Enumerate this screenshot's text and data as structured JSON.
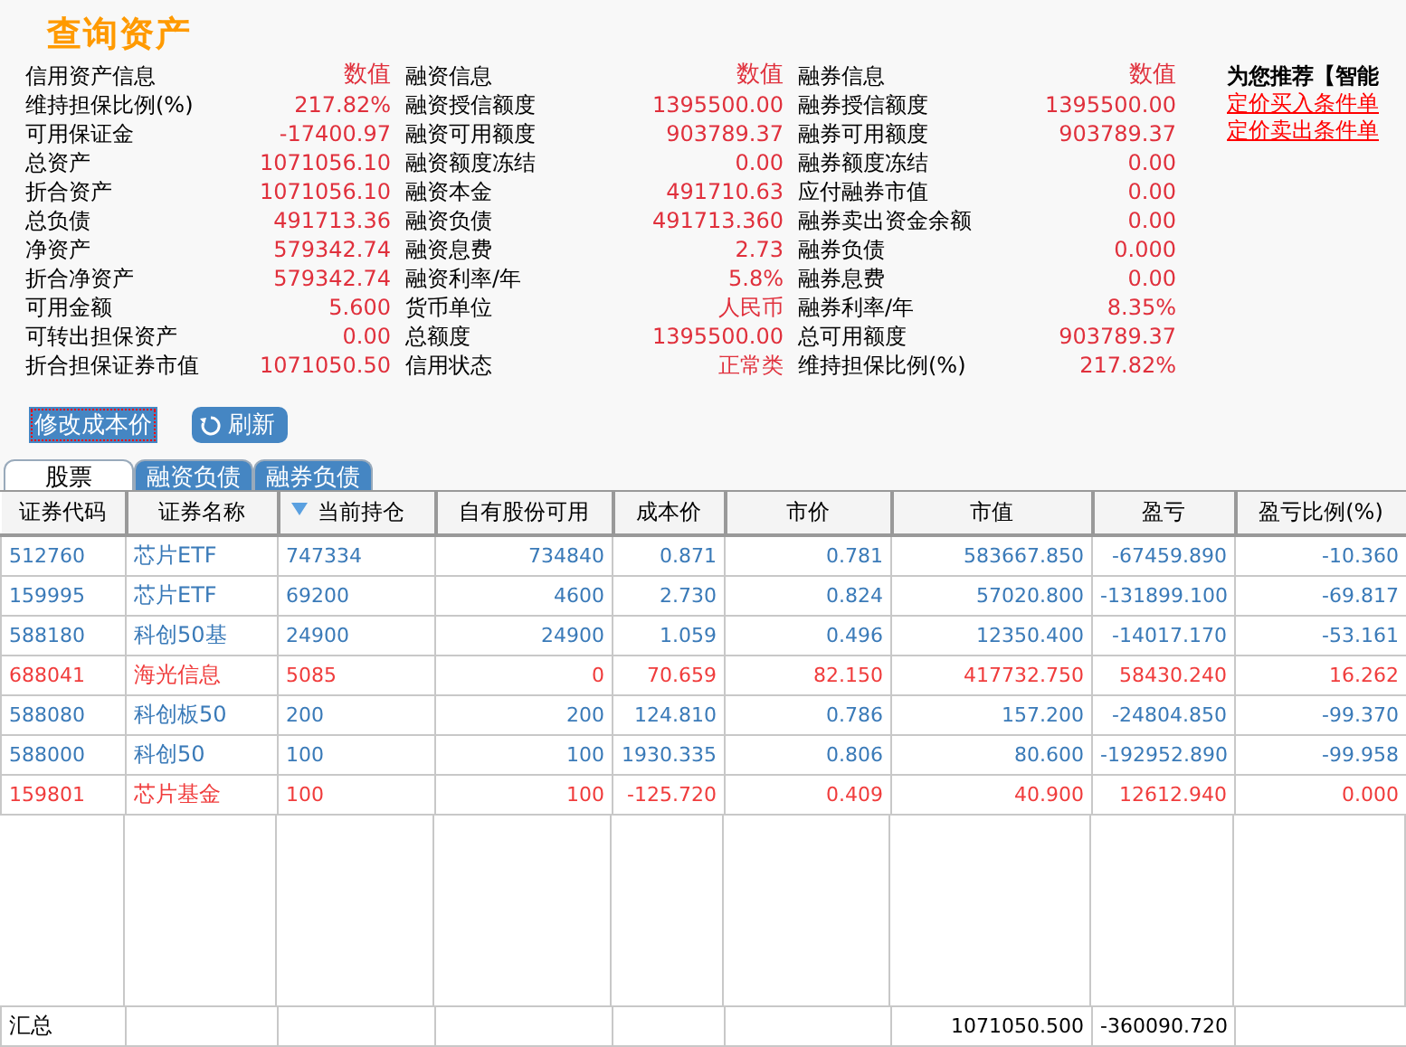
{
  "title": "查询资产",
  "info_groups": [
    {
      "header": "信用资产信息",
      "value_header": "数值",
      "rows": [
        {
          "label": "维持担保比例(%)",
          "value": "217.82%"
        },
        {
          "label": "可用保证金",
          "value": "-17400.97"
        },
        {
          "label": "总资产",
          "value": "1071056.10"
        },
        {
          "label": "折合资产",
          "value": "1071056.10"
        },
        {
          "label": "总负债",
          "value": "491713.36"
        },
        {
          "label": "净资产",
          "value": "579342.74"
        },
        {
          "label": "折合净资产",
          "value": "579342.74"
        },
        {
          "label": "可用金额",
          "value": "5.600"
        },
        {
          "label": "可转出担保资产",
          "value": "0.00"
        },
        {
          "label": "折合担保证券市值",
          "value": "1071050.50"
        }
      ]
    },
    {
      "header": "融资信息",
      "value_header": "数值",
      "rows": [
        {
          "label": "融资授信额度",
          "value": "1395500.00"
        },
        {
          "label": "融资可用额度",
          "value": "903789.37"
        },
        {
          "label": "融资额度冻结",
          "value": "0.00"
        },
        {
          "label": "融资本金",
          "value": "491710.63"
        },
        {
          "label": "融资负债",
          "value": "491713.360"
        },
        {
          "label": "融资息费",
          "value": "2.73"
        },
        {
          "label": "融资利率/年",
          "value": "5.8%"
        },
        {
          "label": "货币单位",
          "value": "人民币"
        },
        {
          "label": "总额度",
          "value": "1395500.00"
        },
        {
          "label": "信用状态",
          "value": "正常类"
        }
      ]
    },
    {
      "header": "融券信息",
      "value_header": "数值",
      "rows": [
        {
          "label": "融券授信额度",
          "value": "1395500.00"
        },
        {
          "label": "融券可用额度",
          "value": "903789.37"
        },
        {
          "label": "融券额度冻结",
          "value": "0.00"
        },
        {
          "label": "应付融券市值",
          "value": "0.00"
        },
        {
          "label": "融券卖出资金余额",
          "value": "0.00"
        },
        {
          "label": "融券负债",
          "value": "0.000"
        },
        {
          "label": "融券息费",
          "value": "0.00"
        },
        {
          "label": "融券利率/年",
          "value": "8.35%"
        },
        {
          "label": "总可用额度",
          "value": "903789.37"
        },
        {
          "label": "维持担保比例(%)",
          "value": "217.82%"
        }
      ]
    }
  ],
  "recommend": {
    "heading": "为您推荐【智能",
    "links": [
      "定价买入条件单",
      "定价卖出条件单"
    ]
  },
  "buttons": [
    {
      "label": "修改成本价",
      "focused": true,
      "kind": "plain"
    },
    {
      "label": "刷新",
      "focused": false,
      "kind": "refresh"
    }
  ],
  "tabs": [
    {
      "label": "股票",
      "selected": true
    },
    {
      "label": "融资负债",
      "selected": false
    },
    {
      "label": "融券负债",
      "selected": false
    }
  ],
  "table": {
    "columns": [
      {
        "label": "证券代码",
        "sorted": false
      },
      {
        "label": "证券名称",
        "sorted": false
      },
      {
        "label": "当前持仓",
        "sorted": true
      },
      {
        "label": "自有股份可用",
        "sorted": false
      },
      {
        "label": "成本价",
        "sorted": false
      },
      {
        "label": "市价",
        "sorted": false
      },
      {
        "label": "市值",
        "sorted": false
      },
      {
        "label": "盈亏",
        "sorted": false
      },
      {
        "label": "盈亏比例(%)",
        "sorted": false
      }
    ],
    "rows": [
      {
        "color": "#3a7ab8",
        "cells": [
          "512760",
          "芯片ETF",
          "747334",
          "734840",
          "0.871",
          "0.781",
          "583667.850",
          "-67459.890",
          "-10.360"
        ]
      },
      {
        "color": "#3a7ab8",
        "cells": [
          "159995",
          "芯片ETF",
          "69200",
          "4600",
          "2.730",
          "0.824",
          "57020.800",
          "-131899.100",
          "-69.817"
        ]
      },
      {
        "color": "#3a7ab8",
        "cells": [
          "588180",
          "科创50基",
          "24900",
          "24900",
          "1.059",
          "0.496",
          "12350.400",
          "-14017.170",
          "-53.161"
        ]
      },
      {
        "color": "#f03c3c",
        "cells": [
          "688041",
          "海光信息",
          "5085",
          "0",
          "70.659",
          "82.150",
          "417732.750",
          "58430.240",
          "16.262"
        ]
      },
      {
        "color": "#3a7ab8",
        "cells": [
          "588080",
          "科创板50",
          "200",
          "200",
          "124.810",
          "0.786",
          "157.200",
          "-24804.850",
          "-99.370"
        ]
      },
      {
        "color": "#3a7ab8",
        "cells": [
          "588000",
          "科创50",
          "100",
          "100",
          "1930.335",
          "0.806",
          "80.600",
          "-192952.890",
          "-99.958"
        ]
      },
      {
        "color": "#f03c3c",
        "cells": [
          "159801",
          "芯片基金",
          "100",
          "100",
          "-125.720",
          "0.409",
          "40.900",
          "12612.940",
          "0.000"
        ]
      }
    ],
    "total": {
      "label": "汇总",
      "market_value": "1071050.500",
      "pnl": "-360090.720"
    }
  }
}
